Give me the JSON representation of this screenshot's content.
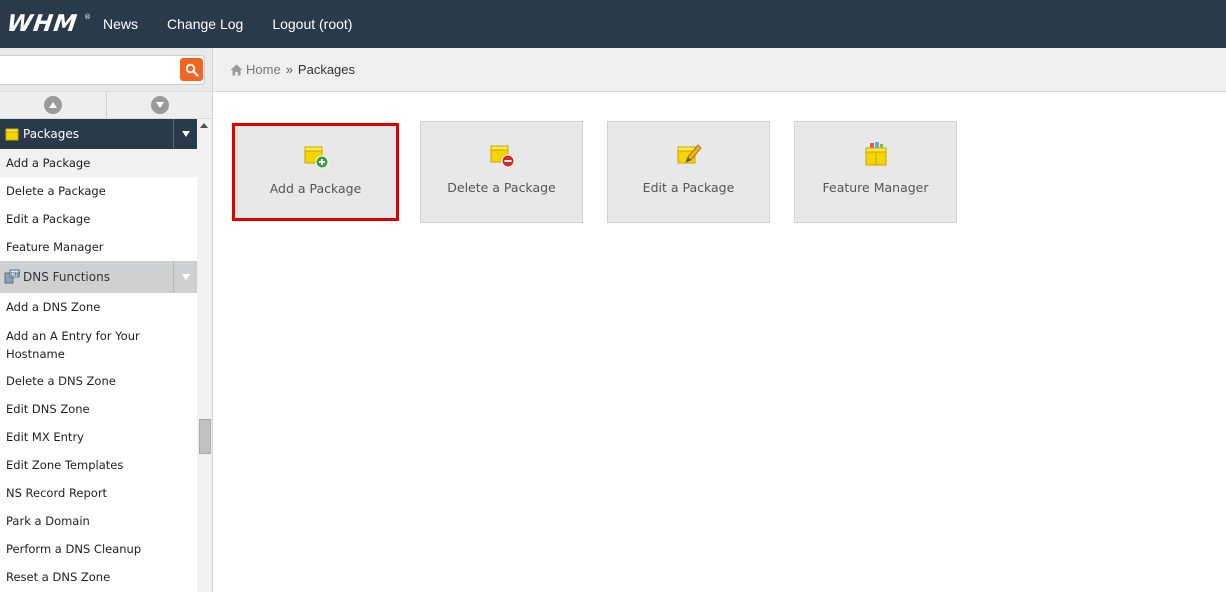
{
  "app": {
    "logo_text": "WHM",
    "logo_mark": "®"
  },
  "topnav": {
    "items": [
      "News",
      "Change Log",
      "Logout (root)"
    ]
  },
  "search": {
    "value": "",
    "placeholder": ""
  },
  "sidebar": {
    "categories": [
      {
        "label": "Packages",
        "icon": "package-icon",
        "expanded": true,
        "items": [
          "Add a Package",
          "Delete a Package",
          "Edit a Package",
          "Feature Manager"
        ]
      },
      {
        "label": "DNS Functions",
        "icon": "dns-icon",
        "expanded": true,
        "items": [
          "Add a DNS Zone",
          "Add an A Entry for Your Hostname",
          "Delete a DNS Zone",
          "Edit DNS Zone",
          "Edit MX Entry",
          "Edit Zone Templates",
          "NS Record Report",
          "Park a Domain",
          "Perform a DNS Cleanup",
          "Reset a DNS Zone"
        ]
      }
    ],
    "selected_item": "Add a Package"
  },
  "breadcrumb": {
    "home": "Home",
    "separator": "»",
    "current": "Packages"
  },
  "tiles": [
    {
      "label": "Add a Package",
      "icon": "package-add-icon",
      "highlighted": true
    },
    {
      "label": "Delete a Package",
      "icon": "package-delete-icon",
      "highlighted": false
    },
    {
      "label": "Edit a Package",
      "icon": "package-edit-icon",
      "highlighted": false
    },
    {
      "label": "Feature Manager",
      "icon": "feature-manager-icon",
      "highlighted": false
    }
  ],
  "colors": {
    "topbar": "#293a4a",
    "search_button": "#f26522",
    "highlight_border": "#e00000",
    "package_yellow": "#f5d400"
  }
}
